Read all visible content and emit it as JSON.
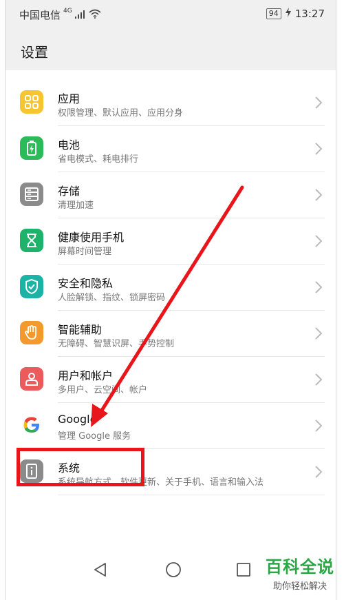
{
  "status_bar": {
    "carrier": "中国电信",
    "network": "4G",
    "battery": "94",
    "time": "13:27"
  },
  "header": {
    "title": "设置"
  },
  "settings_items": [
    {
      "title": "应用",
      "subtitle": "权限管理、默认应用、应用分身",
      "icon": "apps-grid-icon",
      "color": "#f7c52f"
    },
    {
      "title": "电池",
      "subtitle": "省电模式、耗电排行",
      "icon": "battery-icon",
      "color": "#2dbb5a"
    },
    {
      "title": "存储",
      "subtitle": "清理加速",
      "icon": "storage-icon",
      "color": "#8b8b8b"
    },
    {
      "title": "健康使用手机",
      "subtitle": "屏幕时间管理",
      "icon": "hourglass-icon",
      "color": "#1fb26a"
    },
    {
      "title": "安全和隐私",
      "subtitle": "人脸解锁、指纹、锁屏密码",
      "icon": "shield-check-icon",
      "color": "#1cb3a6"
    },
    {
      "title": "智能辅助",
      "subtitle": "无障碍、智慧识屏、手势控制",
      "icon": "hand-icon",
      "color": "#f49a2c"
    },
    {
      "title": "用户和帐户",
      "subtitle": "多用户、云空间、帐户",
      "icon": "user-icon",
      "color": "#ec5b5b"
    },
    {
      "title": "Google",
      "subtitle": "管理 Google 服务",
      "icon": "google-icon",
      "color": "#ffffff"
    },
    {
      "title": "系统",
      "subtitle": "系统导航方式、软件更新、关于手机、语言和输入法",
      "icon": "system-info-icon",
      "color": "#8b8b8b"
    }
  ],
  "navigation": {
    "back": "back-triangle-icon",
    "home": "home-circle-icon",
    "recent": "recent-square-icon"
  },
  "watermark": {
    "title": "百科全说",
    "subtitle": "助你轻松解决"
  },
  "annotation": {
    "arrow_color": "#e8151b",
    "highlight_target": "系统"
  }
}
